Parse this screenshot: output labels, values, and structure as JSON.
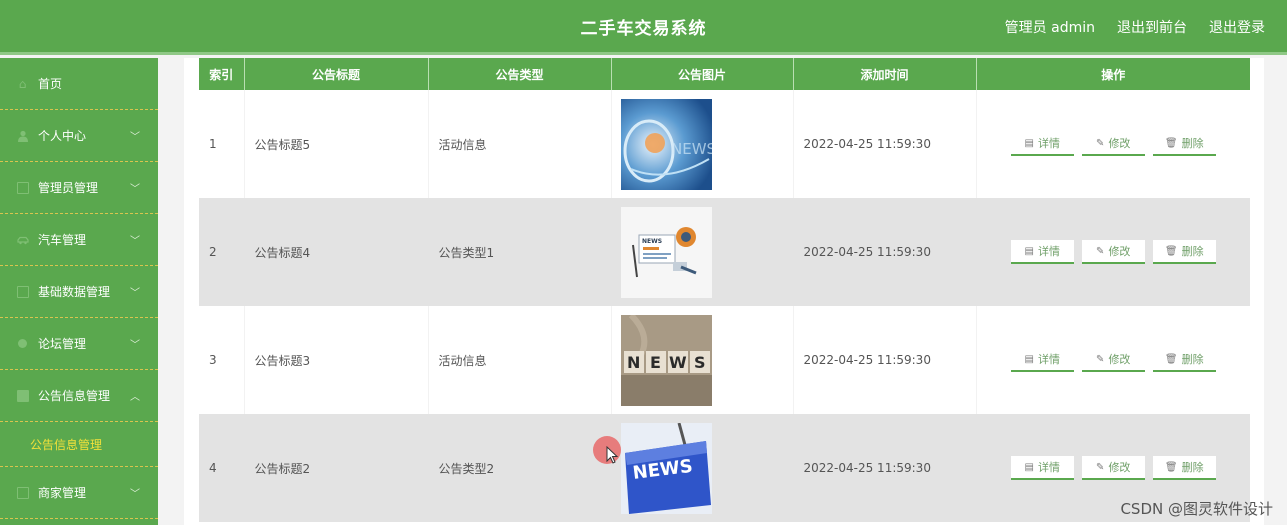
{
  "header": {
    "title": "二手车交易系统",
    "admin_label": "管理员 admin",
    "front_label": "退出到前台",
    "logout_label": "退出登录"
  },
  "sidebar": {
    "items": [
      {
        "label": "首页",
        "icon": "home-icon"
      },
      {
        "label": "个人中心",
        "icon": "user-icon"
      },
      {
        "label": "管理员管理",
        "icon": "square-icon"
      },
      {
        "label": "汽车管理",
        "icon": "car-icon"
      },
      {
        "label": "基础数据管理",
        "icon": "square-icon"
      },
      {
        "label": "论坛管理",
        "icon": "circle-icon"
      },
      {
        "label": "公告信息管理",
        "icon": "square-icon"
      },
      {
        "label": "商家管理",
        "icon": "square-icon"
      }
    ],
    "active_sub": "公告信息管理"
  },
  "table": {
    "headers": [
      "索引",
      "公告标题",
      "公告类型",
      "公告图片",
      "添加时间",
      "操作"
    ],
    "rows": [
      {
        "index": "1",
        "title": "公告标题5",
        "type": "活动信息",
        "time": "2022-04-25 11:59:30"
      },
      {
        "index": "2",
        "title": "公告标题4",
        "type": "公告类型1",
        "time": "2022-04-25 11:59:30"
      },
      {
        "index": "3",
        "title": "公告标题3",
        "type": "活动信息",
        "time": "2022-04-25 11:59:30"
      },
      {
        "index": "4",
        "title": "公告标题2",
        "type": "公告类型2",
        "time": "2022-04-25 11:59:30"
      }
    ],
    "actions": {
      "detail": "详情",
      "edit": "修改",
      "delete": "删除"
    },
    "images": {
      "news_text": "NEWS",
      "news_letters": [
        "N",
        "E",
        "W",
        "S"
      ]
    }
  },
  "watermark": "CSDN @图灵软件设计",
  "colors": {
    "brand": "#5aa84e",
    "accent_sub": "#f2e13a"
  }
}
